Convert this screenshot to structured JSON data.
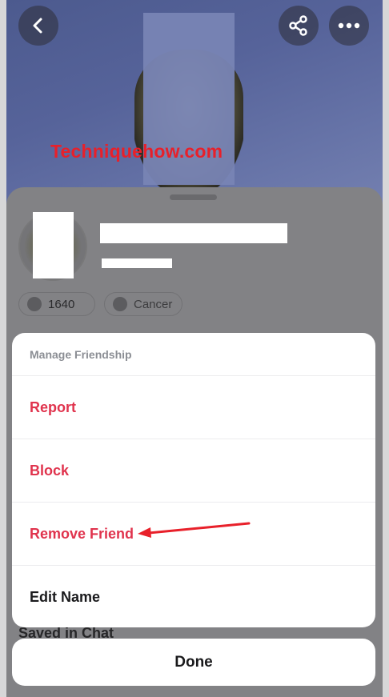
{
  "watermark": "Techniquehow.com",
  "header": {
    "back_icon": "chevron-left-icon",
    "share_icon": "share-icon",
    "more_icon": "more-horizontal-icon"
  },
  "profile": {
    "score": "1640",
    "zodiac": "Cancer",
    "score_icon": "ghost-icon",
    "zodiac_icon": "cancer-zodiac-icon"
  },
  "sections": {
    "saved_in_chat": "Saved in Chat"
  },
  "action_sheet": {
    "title": "Manage Friendship",
    "items": [
      {
        "label": "Report",
        "style": "danger"
      },
      {
        "label": "Block",
        "style": "danger"
      },
      {
        "label": "Remove Friend",
        "style": "danger"
      },
      {
        "label": "Edit Name",
        "style": "normal"
      }
    ],
    "done_label": "Done"
  },
  "colors": {
    "danger": "#e0334d",
    "annotation_arrow": "#e8202a",
    "watermark": "#e8202a"
  }
}
